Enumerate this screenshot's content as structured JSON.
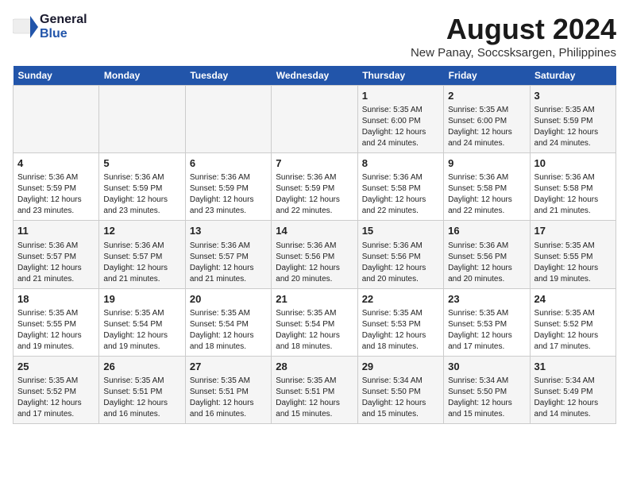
{
  "logo": {
    "general": "General",
    "blue": "Blue"
  },
  "title": "August 2024",
  "location": "New Panay, Soccsksargen, Philippines",
  "weekdays": [
    "Sunday",
    "Monday",
    "Tuesday",
    "Wednesday",
    "Thursday",
    "Friday",
    "Saturday"
  ],
  "weeks": [
    [
      {
        "day": "",
        "info": ""
      },
      {
        "day": "",
        "info": ""
      },
      {
        "day": "",
        "info": ""
      },
      {
        "day": "",
        "info": ""
      },
      {
        "day": "1",
        "info": "Sunrise: 5:35 AM\nSunset: 6:00 PM\nDaylight: 12 hours\nand 24 minutes."
      },
      {
        "day": "2",
        "info": "Sunrise: 5:35 AM\nSunset: 6:00 PM\nDaylight: 12 hours\nand 24 minutes."
      },
      {
        "day": "3",
        "info": "Sunrise: 5:35 AM\nSunset: 5:59 PM\nDaylight: 12 hours\nand 24 minutes."
      }
    ],
    [
      {
        "day": "4",
        "info": "Sunrise: 5:36 AM\nSunset: 5:59 PM\nDaylight: 12 hours\nand 23 minutes."
      },
      {
        "day": "5",
        "info": "Sunrise: 5:36 AM\nSunset: 5:59 PM\nDaylight: 12 hours\nand 23 minutes."
      },
      {
        "day": "6",
        "info": "Sunrise: 5:36 AM\nSunset: 5:59 PM\nDaylight: 12 hours\nand 23 minutes."
      },
      {
        "day": "7",
        "info": "Sunrise: 5:36 AM\nSunset: 5:59 PM\nDaylight: 12 hours\nand 22 minutes."
      },
      {
        "day": "8",
        "info": "Sunrise: 5:36 AM\nSunset: 5:58 PM\nDaylight: 12 hours\nand 22 minutes."
      },
      {
        "day": "9",
        "info": "Sunrise: 5:36 AM\nSunset: 5:58 PM\nDaylight: 12 hours\nand 22 minutes."
      },
      {
        "day": "10",
        "info": "Sunrise: 5:36 AM\nSunset: 5:58 PM\nDaylight: 12 hours\nand 21 minutes."
      }
    ],
    [
      {
        "day": "11",
        "info": "Sunrise: 5:36 AM\nSunset: 5:57 PM\nDaylight: 12 hours\nand 21 minutes."
      },
      {
        "day": "12",
        "info": "Sunrise: 5:36 AM\nSunset: 5:57 PM\nDaylight: 12 hours\nand 21 minutes."
      },
      {
        "day": "13",
        "info": "Sunrise: 5:36 AM\nSunset: 5:57 PM\nDaylight: 12 hours\nand 21 minutes."
      },
      {
        "day": "14",
        "info": "Sunrise: 5:36 AM\nSunset: 5:56 PM\nDaylight: 12 hours\nand 20 minutes."
      },
      {
        "day": "15",
        "info": "Sunrise: 5:36 AM\nSunset: 5:56 PM\nDaylight: 12 hours\nand 20 minutes."
      },
      {
        "day": "16",
        "info": "Sunrise: 5:36 AM\nSunset: 5:56 PM\nDaylight: 12 hours\nand 20 minutes."
      },
      {
        "day": "17",
        "info": "Sunrise: 5:35 AM\nSunset: 5:55 PM\nDaylight: 12 hours\nand 19 minutes."
      }
    ],
    [
      {
        "day": "18",
        "info": "Sunrise: 5:35 AM\nSunset: 5:55 PM\nDaylight: 12 hours\nand 19 minutes."
      },
      {
        "day": "19",
        "info": "Sunrise: 5:35 AM\nSunset: 5:54 PM\nDaylight: 12 hours\nand 19 minutes."
      },
      {
        "day": "20",
        "info": "Sunrise: 5:35 AM\nSunset: 5:54 PM\nDaylight: 12 hours\nand 18 minutes."
      },
      {
        "day": "21",
        "info": "Sunrise: 5:35 AM\nSunset: 5:54 PM\nDaylight: 12 hours\nand 18 minutes."
      },
      {
        "day": "22",
        "info": "Sunrise: 5:35 AM\nSunset: 5:53 PM\nDaylight: 12 hours\nand 18 minutes."
      },
      {
        "day": "23",
        "info": "Sunrise: 5:35 AM\nSunset: 5:53 PM\nDaylight: 12 hours\nand 17 minutes."
      },
      {
        "day": "24",
        "info": "Sunrise: 5:35 AM\nSunset: 5:52 PM\nDaylight: 12 hours\nand 17 minutes."
      }
    ],
    [
      {
        "day": "25",
        "info": "Sunrise: 5:35 AM\nSunset: 5:52 PM\nDaylight: 12 hours\nand 17 minutes."
      },
      {
        "day": "26",
        "info": "Sunrise: 5:35 AM\nSunset: 5:51 PM\nDaylight: 12 hours\nand 16 minutes."
      },
      {
        "day": "27",
        "info": "Sunrise: 5:35 AM\nSunset: 5:51 PM\nDaylight: 12 hours\nand 16 minutes."
      },
      {
        "day": "28",
        "info": "Sunrise: 5:35 AM\nSunset: 5:51 PM\nDaylight: 12 hours\nand 15 minutes."
      },
      {
        "day": "29",
        "info": "Sunrise: 5:34 AM\nSunset: 5:50 PM\nDaylight: 12 hours\nand 15 minutes."
      },
      {
        "day": "30",
        "info": "Sunrise: 5:34 AM\nSunset: 5:50 PM\nDaylight: 12 hours\nand 15 minutes."
      },
      {
        "day": "31",
        "info": "Sunrise: 5:34 AM\nSunset: 5:49 PM\nDaylight: 12 hours\nand 14 minutes."
      }
    ]
  ]
}
